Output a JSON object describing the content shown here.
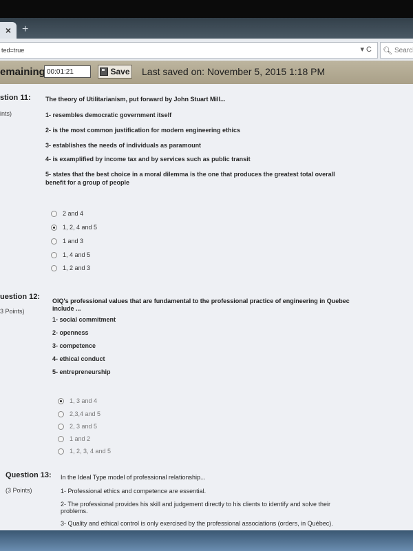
{
  "browser": {
    "tab_close": "×",
    "new_tab": "+",
    "url": "ted=true",
    "url_controls": "▾ C",
    "search_placeholder": "Search"
  },
  "timer_bar": {
    "label": "emaining:",
    "time_value": "00:01:21",
    "save_label": "Save",
    "last_saved": "Last saved on: November 5, 2015 1:18 PM"
  },
  "questions": [
    {
      "label": "stion 11:",
      "points": "ints)",
      "title": "The theory of Utilitarianism, put forward by John Stuart Mill...",
      "statements": [
        "1- resembles democratic government itself",
        "2- is the most common justification for modern engineering ethics",
        "3- establishes the needs of individuals as paramount",
        "4- is examplified by income tax and by services such as public transit",
        "5- states that the best choice in a moral dilemma is the one that produces the greatest total overall",
        "benefit for a group of people"
      ],
      "options": [
        "2 and 4",
        "1, 2, 4 and 5",
        "1 and 3",
        "1, 4 and 5",
        "1, 2 and 3"
      ],
      "selected_index": 1
    },
    {
      "label": "uestion 12:",
      "points": "3 Points)",
      "title_lines": [
        "OIQ's professional values that are fundamental to the professional practice of engineering in Quebec",
        "include ..."
      ],
      "statements": [
        "1- social commitment",
        "2- openness",
        "3- competence",
        "4- ethical conduct",
        "5- entrepreneurship"
      ],
      "options": [
        "1, 3 and 4",
        "2,3,4 and 5",
        "2, 3 and 5",
        "1 and 2",
        "1, 2, 3, 4 and 5"
      ],
      "selected_index": 0
    },
    {
      "label": "Question 13:",
      "points": "(3 Points)",
      "title": "In the Ideal Type model of professional relationship...",
      "statements": [
        "1- Professional ethics and competence are essential.",
        "2- The professional provides his skill and judgement directly to his clients to identify and solve their",
        "problems.",
        "3- Quality and ethical control is only exercised by the professional associations (orders, in Québec)."
      ]
    }
  ]
}
